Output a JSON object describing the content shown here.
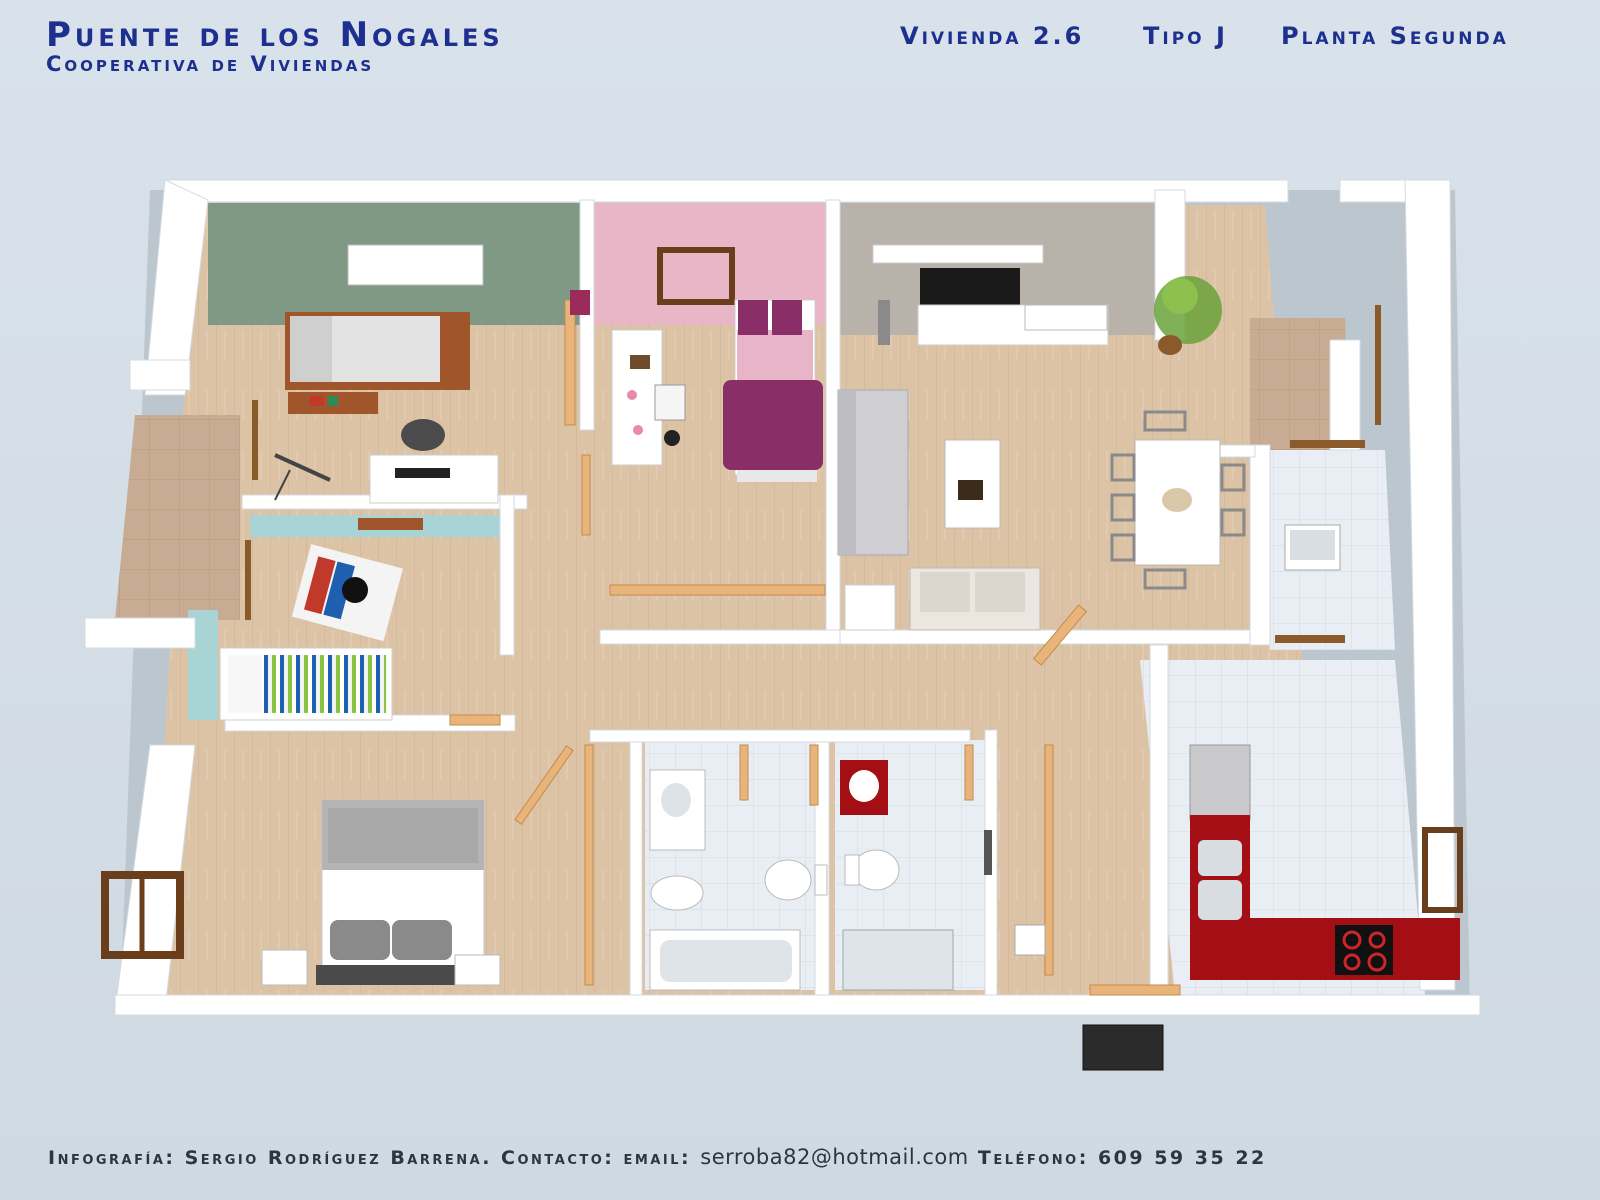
{
  "header": {
    "title": "Puente de los Nogales",
    "subtitle": "Cooperativa de Viviendas",
    "vivienda": "Vivienda 2.6",
    "tipo": "Tipo J",
    "planta": "Planta Segunda"
  },
  "footer": {
    "credit": "Infografía: Sergio Rodríguez Barrena. Contacto: email:",
    "email": "serroba82@hotmail.com",
    "phone": "Teléfono: 609 59 35 22"
  },
  "colors": {
    "title_blue": "#1d2f8f",
    "floor_wood": "#dcc3a6",
    "wall": "#ffffff",
    "green_wall": "#7f9985",
    "pink_wall": "#e9b6c8",
    "gray_wall": "#b9b2aa",
    "kitchen_red": "#a40f16",
    "tile": "#e7edf2"
  },
  "plan": {
    "rooms": [
      "bedroom-study",
      "bedroom-pink",
      "living-dining",
      "kids-room",
      "master-bedroom",
      "bathroom-1",
      "bathroom-2",
      "kitchen",
      "terrace-left",
      "terrace-right"
    ]
  }
}
